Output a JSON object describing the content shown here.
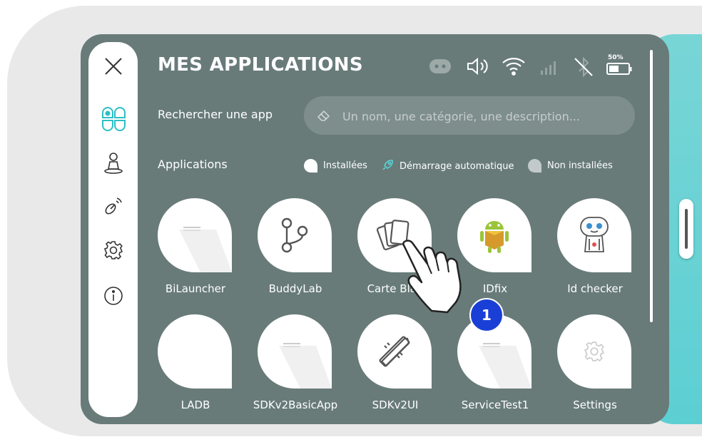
{
  "header": {
    "title": "MES APPLICATIONS",
    "battery_percent": "50%"
  },
  "search": {
    "label": "Rechercher une app",
    "placeholder": "Un nom, une catégorie, une description..."
  },
  "apps_section": {
    "label": "Applications",
    "legend": [
      {
        "label": "Installées",
        "icon": "installed-dot"
      },
      {
        "label": "Démarrage automatique",
        "icon": "rocket-icon"
      },
      {
        "label": "Non installées",
        "icon": "not-installed-dot"
      }
    ]
  },
  "apps": [
    {
      "name": "BiLauncher",
      "icon": "default-app-icon"
    },
    {
      "name": "BuddyLab",
      "icon": "branch-icon"
    },
    {
      "name": "Carte Blan",
      "icon": "cards-icon"
    },
    {
      "name": "IDfix",
      "icon": "android-icon"
    },
    {
      "name": "Id checker",
      "icon": "robot-icon"
    },
    {
      "name": "LADB",
      "icon": "blank-icon"
    },
    {
      "name": "SDKv2BasicApp",
      "icon": "default-app-icon"
    },
    {
      "name": "SDKv2UI",
      "icon": "ruler-pencil-icon"
    },
    {
      "name": "ServiceTest1",
      "icon": "default-app-icon"
    },
    {
      "name": "Settings",
      "icon": "gear-icon"
    }
  ],
  "overlay": {
    "step_badge": "1"
  },
  "colors": {
    "screen_bg": "#687b79",
    "accent_teal": "#5ccfd3",
    "badge_blue": "#1a3fd6"
  }
}
